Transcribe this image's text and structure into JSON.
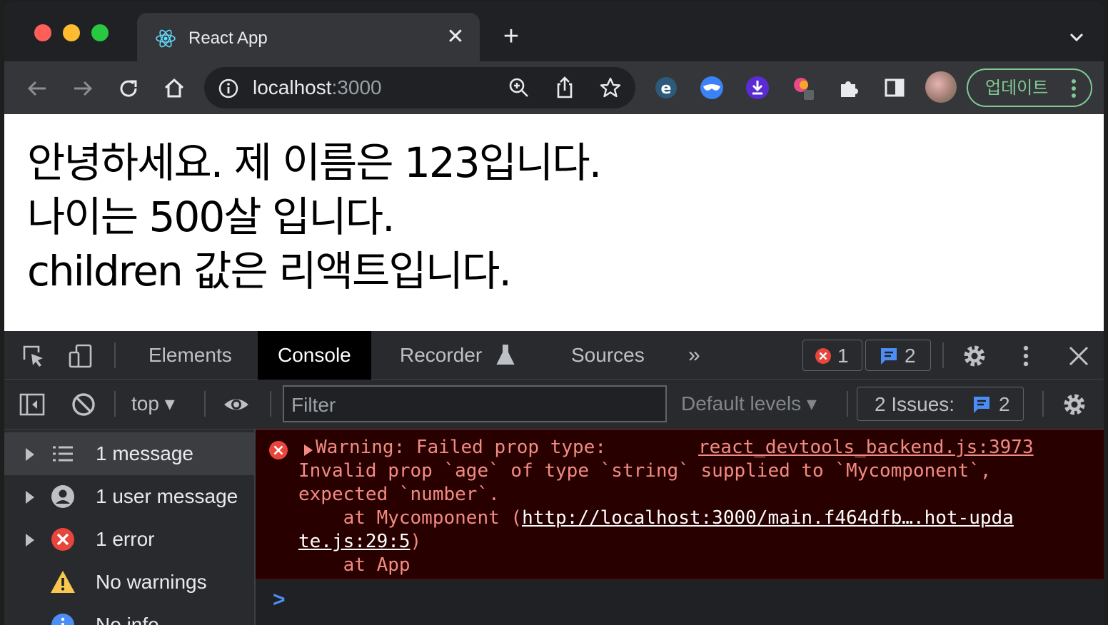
{
  "browser": {
    "tab": {
      "title": "React App",
      "close": "✕"
    },
    "new_tab": "+",
    "omnibox": {
      "host": "localhost",
      "port": ":3000"
    },
    "update_button": "업데이트",
    "icons": [
      "back-icon",
      "forward-icon",
      "reload-icon",
      "home-icon",
      "site-info-icon",
      "zoom-icon",
      "share-icon",
      "bookmark-star-icon",
      "extensions-icon",
      "side-panel-icon"
    ]
  },
  "page": {
    "lines": [
      "안녕하세요. 제 이름은 123입니다.",
      "나이는 500살 입니다.",
      "children 값은 리액트입니다."
    ]
  },
  "devtools": {
    "tabs": [
      "Elements",
      "Console",
      "Recorder",
      "Sources"
    ],
    "active_tab": "Console",
    "more_tabs": "»",
    "error_count": "1",
    "message_count": "2",
    "toolbar": {
      "context": "top",
      "filter_placeholder": "Filter",
      "levels": "Default levels",
      "issues_label": "2 Issues:",
      "issues_count": "2"
    },
    "sidebar": [
      {
        "label": "1 message"
      },
      {
        "label": "1 user message"
      },
      {
        "label": "1 error"
      },
      {
        "label": "No warnings"
      },
      {
        "label": "No info"
      }
    ],
    "console": {
      "line1": "Warning: Failed prop type:",
      "source": "react_devtools_backend.js:3973",
      "line2": "Invalid prop `age` of type `string` supplied to `Mycomponent`,",
      "line3": "expected `number`.",
      "line4_prefix": "    at Mycomponent (",
      "line4_link": "http://localhost:3000/main.f464dfb….hot-upda",
      "line5_link": "te.js:29:5",
      "line5_suffix": ")",
      "line6": "    at App",
      "prompt": ">"
    }
  },
  "colors": {
    "error_bg": "#290000",
    "error_text": "#f28b82",
    "accent_blue": "#4c8df6",
    "update_green": "#81c995"
  }
}
